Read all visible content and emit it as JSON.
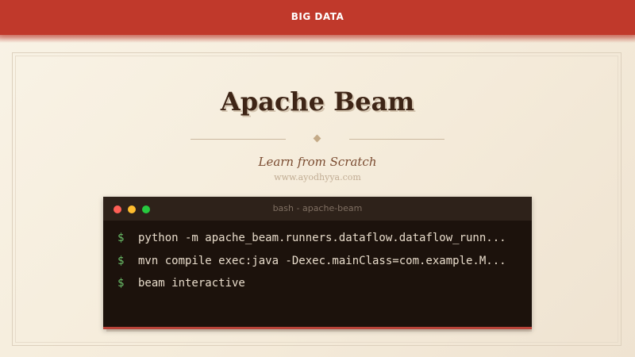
{
  "header": {
    "title": "BIG DATA",
    "color": "#c0392b"
  },
  "slide": {
    "title": "Apache Beam",
    "subtitle": "Learn from Scratch",
    "website": "www.ayodhyya.com",
    "divider_icon": "diamond-icon"
  },
  "terminal": {
    "title": "bash - apache-beam",
    "window_buttons": [
      "close",
      "minimize",
      "maximize"
    ],
    "prompt_symbol": "$",
    "lines": [
      "python -m apache_beam.runners.dataflow.dataflow_runn...",
      "mvn compile exec:java -Dexec.mainClass=com.example.M...",
      "beam interactive"
    ],
    "prompt_color": "#6abf69",
    "background": "#1c120c"
  }
}
